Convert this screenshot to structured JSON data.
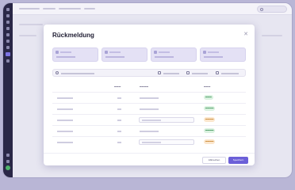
{
  "modal": {
    "title": "Rückmeldung",
    "close_icon": "close-icon"
  },
  "footer": {
    "cancel_label": "Abbrechen",
    "save_label": "Speichern"
  },
  "colors": {
    "accent": "#6b5fd8",
    "sidebar": "#2a2747",
    "status_green": "#2f8a4a",
    "status_orange": "#c27a1e"
  }
}
